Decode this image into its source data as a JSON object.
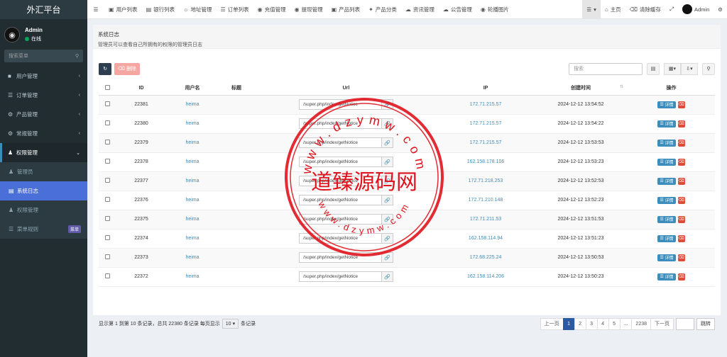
{
  "sidebar": {
    "brand": "外汇平台",
    "user": {
      "name": "Admin",
      "status": "在线"
    },
    "search_placeholder": "搜索菜单",
    "items": [
      {
        "label": "用户管理"
      },
      {
        "label": "订单管理"
      },
      {
        "label": "产品管理"
      },
      {
        "label": "常规管理"
      },
      {
        "label": "权限管理"
      }
    ],
    "sub_items": [
      {
        "label": "管理员"
      },
      {
        "label": "系统日志"
      },
      {
        "label": "权限管理"
      },
      {
        "label": "菜单规则",
        "badge": "菜单"
      }
    ]
  },
  "topbar": {
    "tabs": [
      "用户列表",
      "银行列表",
      "地址管理",
      "订单列表",
      "充值管理",
      "提现管理",
      "产品列表",
      "产品分类",
      "资讯管理",
      "公告管理",
      "轮播图片"
    ],
    "home": "主页",
    "clear_cache": "清除缓存",
    "admin": "Admin"
  },
  "panel": {
    "title": "系统日志",
    "subtitle": "管理员可以查看自己所拥有的权限的管理员日志"
  },
  "toolbar": {
    "delete_label": "删除",
    "search_placeholder": "搜索"
  },
  "table": {
    "columns": [
      "ID",
      "用户名",
      "标题",
      "Url",
      "IP",
      "创建时间",
      "操作"
    ],
    "detail_label": "详情",
    "rows": [
      {
        "id": "22381",
        "user": "heima",
        "title": "",
        "url": "/super.php/index/getNotice",
        "ip": "172.71.215.57",
        "time": "2024-12-12 13:54:52"
      },
      {
        "id": "22380",
        "user": "heima",
        "title": "",
        "url": "/super.php/index/getNotice",
        "ip": "172.71.215.57",
        "time": "2024-12-12 13:54:22"
      },
      {
        "id": "22379",
        "user": "heima",
        "title": "",
        "url": "/super.php/index/getNotice",
        "ip": "172.71.215.57",
        "time": "2024-12-12 13:53:53"
      },
      {
        "id": "22378",
        "user": "heima",
        "title": "",
        "url": "/super.php/index/getNotice",
        "ip": "162.158.178.106",
        "time": "2024-12-12 13:53:23"
      },
      {
        "id": "22377",
        "user": "heima",
        "title": "",
        "url": "/super.php/index/getNotice",
        "ip": "172.71.218.253",
        "time": "2024-12-12 13:52:53"
      },
      {
        "id": "22376",
        "user": "heima",
        "title": "",
        "url": "/super.php/index/getNotice",
        "ip": "172.71.210.148",
        "time": "2024-12-12 13:52:23"
      },
      {
        "id": "22375",
        "user": "heima",
        "title": "",
        "url": "/super.php/index/getNotice",
        "ip": "172.71.211.53",
        "time": "2024-12-12 13:51:53"
      },
      {
        "id": "22374",
        "user": "heima",
        "title": "",
        "url": "/super.php/index/getNotice",
        "ip": "162.158.114.94",
        "time": "2024-12-12 13:51:23"
      },
      {
        "id": "22373",
        "user": "heima",
        "title": "",
        "url": "/super.php/index/getNotice",
        "ip": "172.68.225.24",
        "time": "2024-12-12 13:50:53"
      },
      {
        "id": "22372",
        "user": "heima",
        "title": "",
        "url": "/super.php/index/getNotice",
        "ip": "162.158.114.206",
        "time": "2024-12-12 13:50:23"
      }
    ]
  },
  "footer": {
    "summary": "显示第 1 到第 10 条记录，总共 22380 条记录 每页显示",
    "per_page": "10",
    "per_page_suffix": "条记录",
    "pages": [
      "上一页",
      "1",
      "2",
      "3",
      "4",
      "5",
      "...",
      "2238",
      "下一页"
    ],
    "jump": "跳转"
  },
  "watermark": {
    "text_main": "道臻源码网",
    "text_top": "www.dzymw.com",
    "text_bottom": "www.dzymw.com"
  },
  "colors": {
    "sidebar_bg": "#222d32",
    "active_menu": "#4a6fd8",
    "link": "#3c8dbc",
    "watermark": "#e0141e"
  }
}
